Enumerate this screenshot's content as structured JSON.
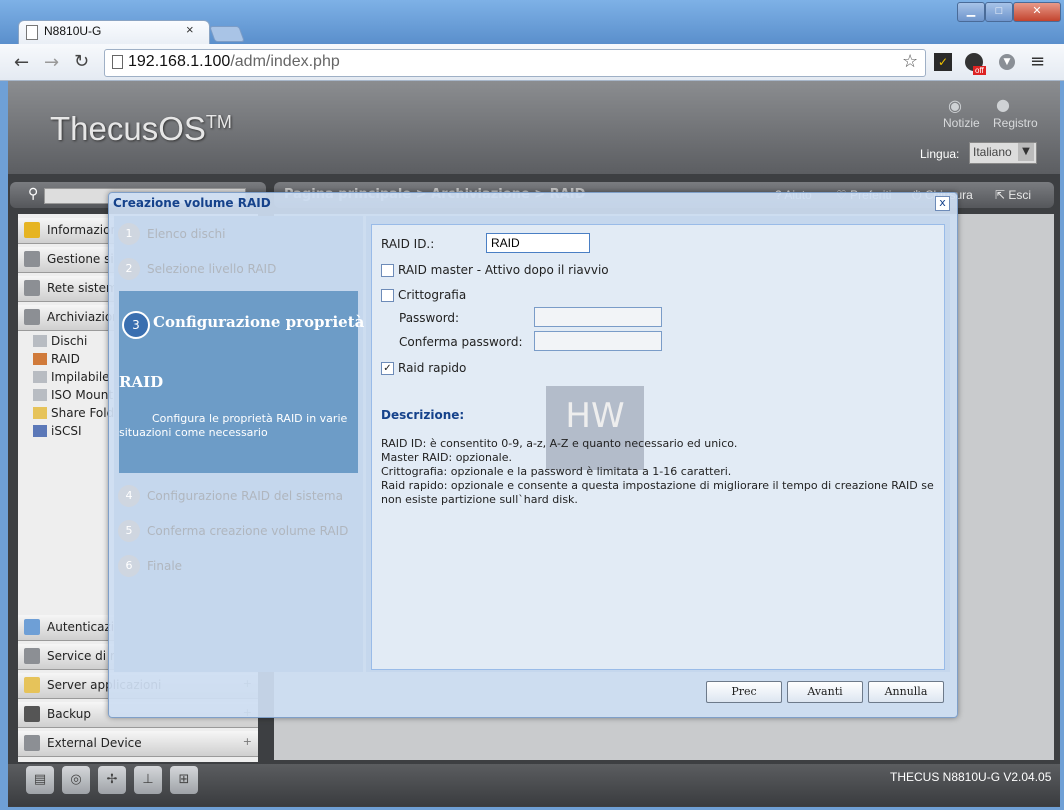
{
  "browser": {
    "tab_title": "N8810U-G",
    "tab_close": "×",
    "url_host": "192.168.1.100",
    "url_path": "/adm/index.php",
    "window_min": "▁",
    "window_max": "□",
    "window_close": "✕",
    "ext_off_badge": "off"
  },
  "header": {
    "logo": "ThecusOS",
    "logo_tm": "TM",
    "notice_label": "Notizie",
    "log_label": "Registro",
    "language_label": "Lingua:",
    "language_value": "Italiano"
  },
  "topnav": {
    "breadcrumb": "Pagina principale > Archiviazione > RAID",
    "help": "Aiuto",
    "favorites": "Preferiti",
    "shutdown": "Chiusura",
    "logout": "Esci"
  },
  "sidebar": {
    "items": [
      {
        "label": "Informazioni"
      },
      {
        "label": "Gestione sistema"
      },
      {
        "label": "Rete sistema"
      },
      {
        "label": "Archiviazione"
      }
    ],
    "storage_subitems": [
      "Dischi",
      "RAID",
      "Impilabile",
      "ISO Mount",
      "Share Folder",
      "iSCSI"
    ],
    "bottom_items": [
      {
        "label": "Autenticazione"
      },
      {
        "label": "Service di rete"
      },
      {
        "label": "Server applicazioni"
      },
      {
        "label": "Backup"
      },
      {
        "label": "External Device"
      }
    ]
  },
  "footer": {
    "version": "THECUS N8810U-G V2.04.05"
  },
  "dialog": {
    "title": "Creazione volume RAID",
    "close": "x",
    "steps": [
      {
        "num": "1",
        "label": "Elenco dischi"
      },
      {
        "num": "2",
        "label": "Selezione livello RAID"
      },
      {
        "num": "3",
        "label": "Configurazione proprietà RAID"
      },
      {
        "num": "4",
        "label": "Configurazione RAID del sistema"
      },
      {
        "num": "5",
        "label": "Conferma creazione volume RAID"
      },
      {
        "num": "6",
        "label": "Finale"
      }
    ],
    "active_step": {
      "num": "3",
      "title_line1": "Configurazione proprietà",
      "title_line2": "RAID",
      "description": "Configura le proprietà RAID in varie situazioni come necessario"
    },
    "form": {
      "raid_id_label": "RAID ID.:",
      "raid_id_value": "RAID",
      "raid_master_label": "RAID master - Attivo dopo il riavvio",
      "raid_master_checked": false,
      "encryption_label": "Crittografia",
      "encryption_checked": false,
      "password_label": "Password:",
      "password_value": "",
      "confirm_password_label": "Conferma password:",
      "confirm_password_value": "",
      "fast_raid_label": "Raid rapido",
      "fast_raid_checked": true
    },
    "description_title": "Descrizione:",
    "description_lines": [
      "RAID ID: è consentito 0-9, a-z, A-Z e quanto necessario ed unico.",
      "Master RAID: opzionale.",
      "Crittografia: opzionale e la password è limitata a 1-16 caratteri.",
      "Raid rapido: opzionale e consente a questa impostazione di migliorare il tempo di creazione RAID se",
      "non esiste partizione sull`hard disk."
    ],
    "buttons": {
      "prev": "Prec",
      "next": "Avanti",
      "cancel": "Annulla"
    }
  }
}
